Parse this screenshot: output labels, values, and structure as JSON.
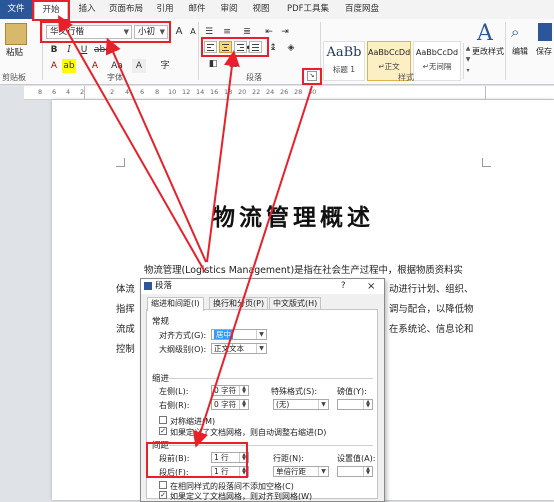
{
  "menu": {
    "tabs": [
      "文件",
      "开始",
      "插入",
      "页面布局",
      "引用",
      "邮件",
      "审阅",
      "视图",
      "PDF工具集",
      "百度网盘"
    ]
  },
  "ribbon": {
    "paste_label": "粘贴",
    "clipboard_label": "剪贴板",
    "font_name": "华文行楷",
    "font_size": "小初",
    "font_group_label": "字体",
    "paragraph_group_label": "段落",
    "styles_group_label": "样式",
    "styles": [
      {
        "preview": "AaBb",
        "caption": "标题 1"
      },
      {
        "preview": "AaBbCcDd",
        "caption": "↵正文"
      },
      {
        "preview": "AaBbCcDd",
        "caption": "↵无间隔"
      }
    ],
    "change_styles_label": "更改样式",
    "edit_label": "编辑",
    "save_label": "保存",
    "bold": "B",
    "italic": "I",
    "underline": "U",
    "font_color_letter": "A",
    "big_a": "A"
  },
  "ruler": {
    "ticks": [
      "8",
      "6",
      "4",
      "2",
      "",
      "2",
      "4",
      "6",
      "8",
      "10",
      "12",
      "14",
      "16",
      "18",
      "20",
      "22",
      "24",
      "26",
      "28",
      "30"
    ]
  },
  "document": {
    "title": "物流管理概述",
    "lines": [
      "物流管理(Logistics Management)是指在社会生产过程中，根据物质资料实",
      "体流",
      "指挥",
      "流成",
      "控制"
    ],
    "line_tails": [
      "动进行计划、组织、",
      "调与配合，以降低物",
      "在系统论、信息论和"
    ]
  },
  "dialog": {
    "title": "段落",
    "question": "?",
    "close": "×",
    "tabs": [
      "缩进和间距(I)",
      "换行和分页(P)",
      "中文版式(H)"
    ],
    "general": {
      "heading": "常规",
      "alignment_label": "对齐方式(G):",
      "alignment_value": "居中",
      "outline_label": "大纲级别(O):",
      "outline_value": "正文文本"
    },
    "indent": {
      "heading": "缩进",
      "left_label": "左侧(L):",
      "left_value": "0 字符",
      "right_label": "右侧(R):",
      "right_value": "0 字符",
      "special_label": "特殊格式(S):",
      "special_value": "(无)",
      "by_label": "磅值(Y):",
      "mirror_label": "对称缩进(M)",
      "auto_label": "如果定义了文档网格，则自动调整右缩进(D)"
    },
    "spacing": {
      "heading": "间距",
      "before_label": "段前(B):",
      "before_value": "1 行",
      "after_label": "段后(F):",
      "after_value": "1 行",
      "line_label": "行距(N):",
      "line_value": "单倍行距",
      "at_label": "设置值(A):",
      "no_space_label": "在相同样式的段落间不添加空格(C)",
      "grid_label": "如果定义了文档网格，则对齐到网格(W)"
    }
  },
  "annotation_color": "#e8202a"
}
